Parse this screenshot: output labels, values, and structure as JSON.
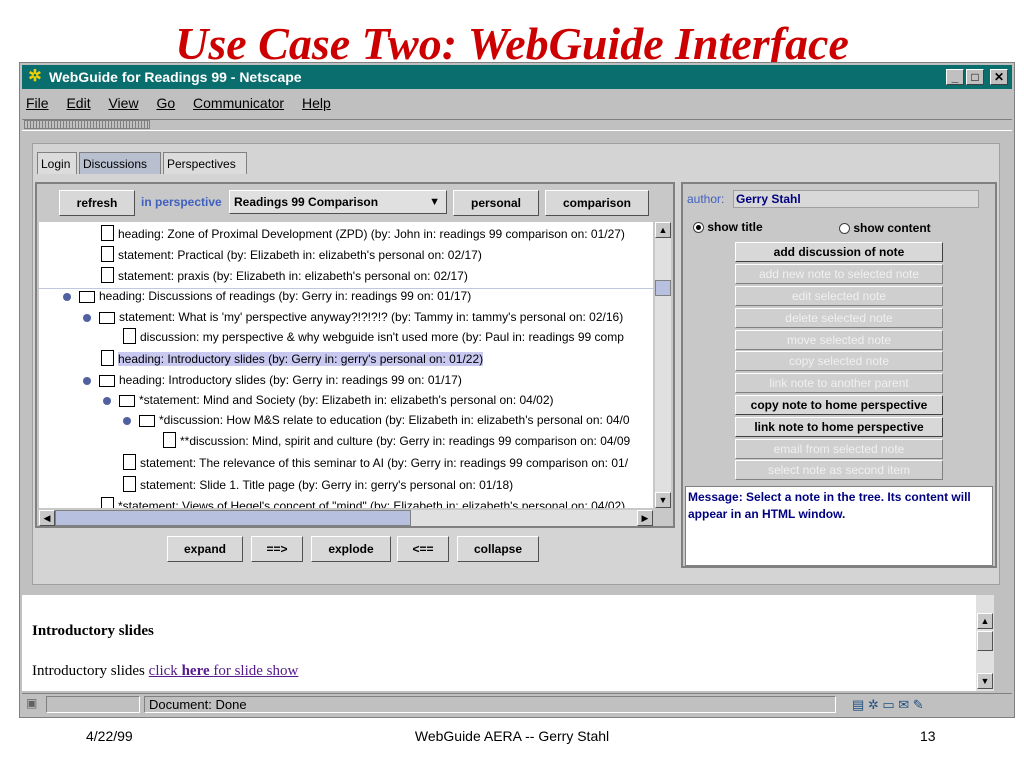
{
  "slide": {
    "title": "Use Case Two: WebGuide Interface",
    "footer_date": "4/22/99",
    "footer_center": "WebGuide AERA -- Gerry Stahl",
    "footer_page": "13"
  },
  "window": {
    "title": "WebGuide for Readings 99 - Netscape",
    "controls": [
      "_",
      "□",
      "✕"
    ]
  },
  "menu": [
    "File",
    "Edit",
    "View",
    "Go",
    "Communicator",
    "Help"
  ],
  "tabs": [
    "Login",
    "Discussions",
    "Perspectives"
  ],
  "tree_toolbar": {
    "refresh": "refresh",
    "in_perspective": "in perspective",
    "perspective_select": "Readings 99 Comparison",
    "personal": "personal",
    "comparison": "comparison"
  },
  "tree_rows": [
    {
      "text": "heading:  Zone of Proximal Development (ZPD)  (by: John in: readings 99 comparison on: 01/27)"
    },
    {
      "text": "statement:  Practical  (by: Elizabeth in: elizabeth's personal on: 02/17)"
    },
    {
      "text": "statement:  praxis  (by: Elizabeth in: elizabeth's personal on: 02/17)"
    },
    {
      "text": "heading:  Discussions of readings  (by: Gerry in: readings 99 on: 01/17)"
    },
    {
      "text": "statement:  What is 'my' perspective anyway?!?!?!?  (by: Tammy in: tammy's personal on: 02/16)"
    },
    {
      "text": "discussion:  my perspective & why webguide isn't used more  (by: Paul in: readings 99 comp"
    },
    {
      "text": "heading:  Introductory slides  (by: Gerry in: gerry's personal on: 01/22)"
    },
    {
      "text": "heading:  Introductory slides  (by: Gerry in: readings 99 on: 01/17)"
    },
    {
      "text": "*statement:  Mind and Society  (by: Elizabeth in: elizabeth's personal on: 04/02)"
    },
    {
      "text": "*discussion:  How M&S relate to education  (by: Elizabeth in: elizabeth's personal on: 04/0"
    },
    {
      "text": "**discussion:  Mind, spirit and culture  (by: Gerry in: readings 99 comparison on: 04/09"
    },
    {
      "text": "statement:  The relevance of this seminar to AI  (by: Gerry in: readings 99 comparison on: 01/"
    },
    {
      "text": "statement:  Slide 1. Title page  (by: Gerry in: gerry's personal on: 01/18)"
    },
    {
      "text": "*statement:  Views of Hegel's concept of \"mind\"  (by: Elizabeth in: elizabeth's personal on: 04/02)"
    }
  ],
  "tree_buttons": {
    "expand": "expand",
    "next": "==>",
    "explode": "explode",
    "prev": "<==",
    "collapse": "collapse"
  },
  "right_panel": {
    "author_label": "author:",
    "author_value": "Gerry Stahl",
    "show_title": "show title",
    "show_content": "show content",
    "buttons": [
      {
        "label": "add discussion of note",
        "enabled": true
      },
      {
        "label": "add new note to selected note",
        "enabled": false
      },
      {
        "label": "edit selected note",
        "enabled": false
      },
      {
        "label": "delete selected note",
        "enabled": false
      },
      {
        "label": "move selected note",
        "enabled": false
      },
      {
        "label": "copy selected note",
        "enabled": false
      },
      {
        "label": "link note to another parent",
        "enabled": false
      },
      {
        "label": "copy note to home perspective",
        "enabled": true
      },
      {
        "label": "link note to home perspective",
        "enabled": true
      },
      {
        "label": "email from selected note",
        "enabled": false
      },
      {
        "label": "select note as second item",
        "enabled": false
      }
    ],
    "message": "Message: Select a note in the tree. Its content will appear in an HTML window."
  },
  "content": {
    "heading": "Introductory slides",
    "text": "Introductory slides",
    "link_pre": "click",
    "link_bold": "here",
    "link_post": "for slide show"
  },
  "status": {
    "text": "Document: Done"
  },
  "colors": {
    "title_red": "#cc0000",
    "titlebar": "#0b6e6e",
    "perspective_blue": "#4060c0",
    "message_navy": "#000080"
  }
}
